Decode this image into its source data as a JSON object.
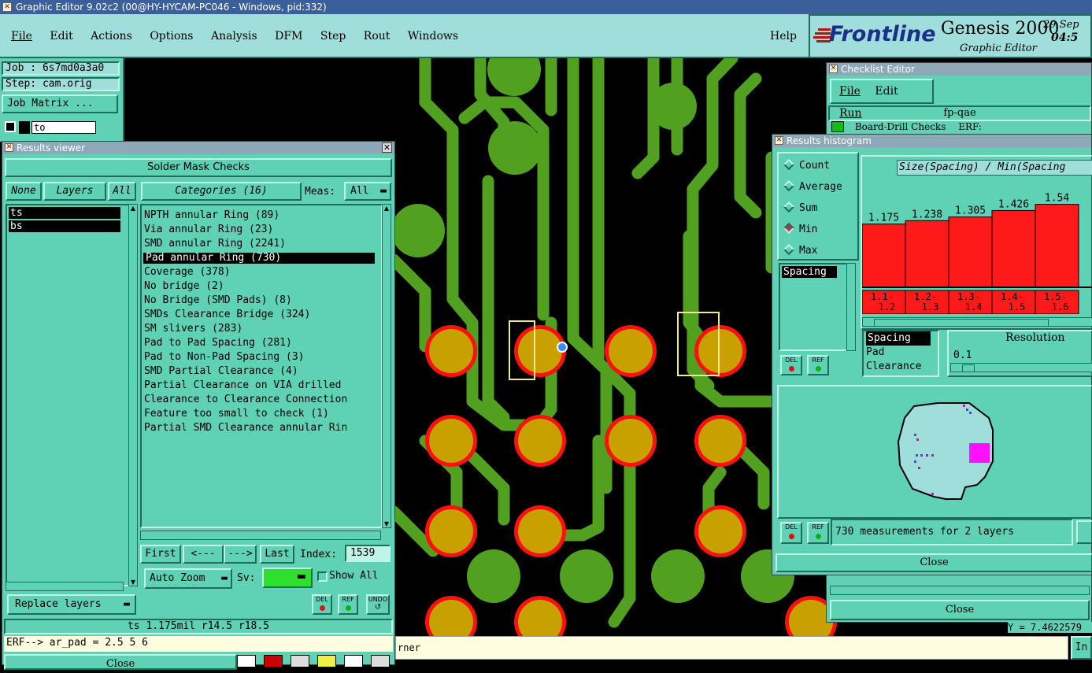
{
  "window": {
    "title": "Graphic Editor 9.02c2 (00@HY-HYCAM-PC046 - Windows, pid:332)"
  },
  "menubar": {
    "items": [
      "File",
      "Edit",
      "Actions",
      "Options",
      "Analysis",
      "DFM",
      "Step",
      "Rout",
      "Windows"
    ],
    "help": "Help"
  },
  "brand": {
    "logo": "Frontline",
    "product": "Genesis 2000",
    "subtitle": "Graphic Editor",
    "date": "29 Sep",
    "time": "04:5"
  },
  "job": {
    "job_label": "Job : 6s7md0a3a0",
    "step_label": "Step: cam.orig",
    "matrix_button": "Job Matrix ...",
    "layer_field": "to"
  },
  "results_viewer": {
    "title": "Results viewer",
    "header": "Solder Mask Checks",
    "none_btn": "None",
    "layers_btn": "Layers",
    "all_btn": "All",
    "layers": [
      "ts",
      "bs"
    ],
    "categories_label": "Categories (16)",
    "meas_label": "Meas:",
    "meas_value": "All",
    "categories": [
      "NPTH annular Ring (89)",
      "Via annular Ring (23)",
      "SMD annular Ring (2241)",
      "Pad annular Ring (730)",
      "Coverage (378)",
      "No bridge (2)",
      "No Bridge (SMD Pads) (8)",
      "SMDs Clearance Bridge (324)",
      "SM slivers (283)",
      "Pad to Pad Spacing (281)",
      "Pad to Non-Pad Spacing (3)",
      "SMD Partial Clearance (4)",
      "Partial Clearance on VIA drilled",
      "Clearance to Clearance Connection",
      "Feature too small to check (1)",
      "Partial SMD Clearance annular Rin"
    ],
    "selected_index": 3,
    "first_btn": "First",
    "prev_btn": "<---",
    "next_btn": "--->",
    "last_btn": "Last",
    "index_label": "Index:",
    "index_value": "1539",
    "autozoom": "Auto Zoom",
    "sv_label": "Sv:",
    "show_all": "Show All",
    "replace_layers": "Replace layers",
    "del": "DEL",
    "ref": "REF",
    "undo": "UNDO",
    "status": "ts 1.175mil  r14.5  r18.5",
    "erf_line": "ERF--> ar_pad = 2.5 5 6",
    "close": "Close"
  },
  "checklist": {
    "title": "Checklist Editor",
    "menu": [
      "File",
      "Edit",
      "Run"
    ],
    "name": "fp-qae",
    "row": "Board-Drill Checks",
    "row_erf": "ERF:",
    "close": "Close",
    "coord": "Y = 7.4622579"
  },
  "histogram": {
    "title": "Results histogram",
    "modes": [
      "Count",
      "Average",
      "Sum",
      "Min",
      "Max"
    ],
    "selected_mode": "Min",
    "list_top": [
      "Spacing"
    ],
    "chart_title": "Size(Spacing) / Min(Spacing",
    "measures": [
      "Spacing",
      "Pad",
      "Clearance"
    ],
    "resolution_label": "Resolution",
    "resolution_value": "0.1",
    "summary": "730 measurements for 2 layers",
    "del": "DEL",
    "ref": "REF",
    "close": "Close"
  },
  "chart_data": {
    "type": "bar",
    "title": "Size(Spacing) / Min(Spacing",
    "categories": [
      "1.1-1.2",
      "1.2-1.3",
      "1.3-1.4",
      "1.4-1.5",
      "1.5-1.6"
    ],
    "bins_display": [
      [
        "1.1-",
        "1.2"
      ],
      [
        "1.2-",
        "1.3"
      ],
      [
        "1.3-",
        "1.4"
      ],
      [
        "1.4-",
        "1.5"
      ],
      [
        "1.5-",
        "1.6"
      ]
    ],
    "values": [
      1.175,
      1.238,
      1.305,
      1.426,
      1.54
    ],
    "labels": [
      "1.175",
      "1.238",
      "1.305",
      "1.426",
      "1.54"
    ],
    "ylim": [
      0,
      1.9
    ],
    "bar_color": "#ff1a1a"
  },
  "bottom": {
    "message": "rner",
    "right_btn": "In"
  },
  "colors": {
    "board_bg": "#000000",
    "trace": "#52a020",
    "pad_ring": "#ff1010",
    "pad_fill": "#c8a000",
    "panel": "#5fd1b5"
  }
}
